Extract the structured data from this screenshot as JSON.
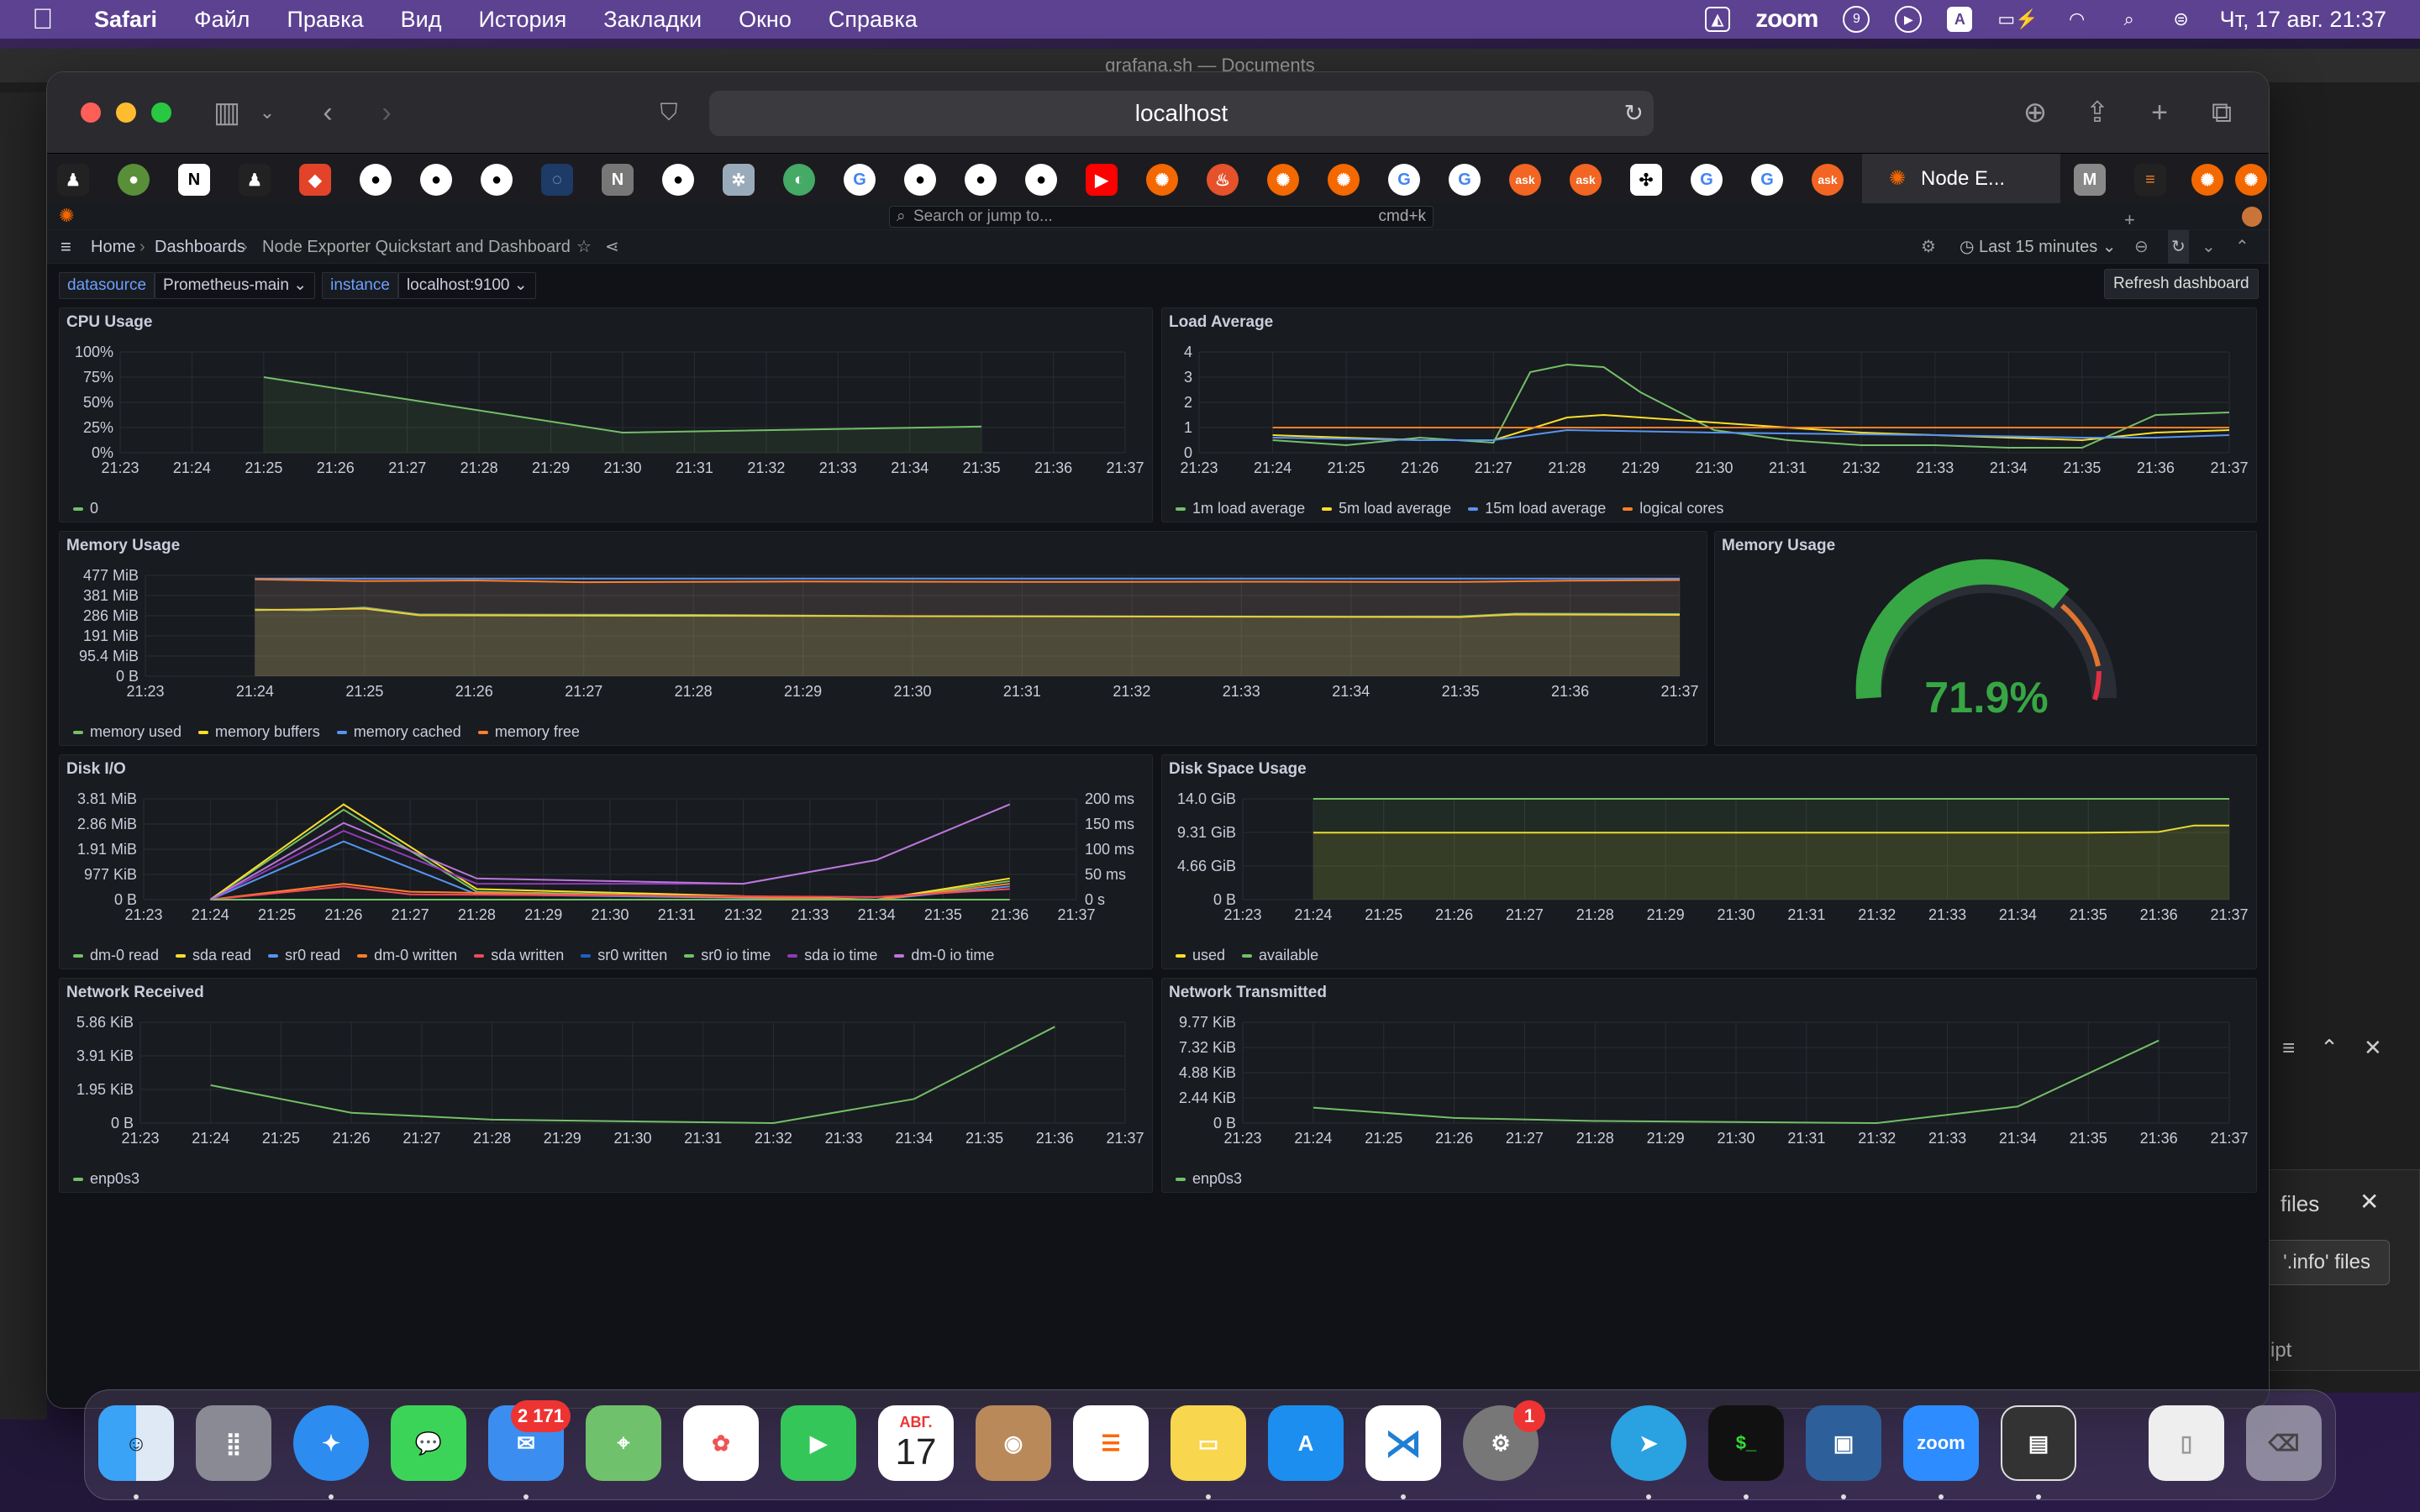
{
  "menubar": {
    "app": "Safari",
    "items": [
      "Файл",
      "Правка",
      "Вид",
      "История",
      "Закладки",
      "Окно",
      "Справка"
    ],
    "zoom": "zoom",
    "datetime": "Чт, 17 авг.  21:37",
    "keyboard": "A",
    "notif_count": "9"
  },
  "vscode": {
    "window_title": "grafana.sh — Documents",
    "files_label": "files",
    "info_label": "'.info' files",
    "script_label": "ipt"
  },
  "safari": {
    "address": "localhost",
    "active_tab": "Node E...",
    "tab_letters": {
      "notion": "N",
      "nav": "N",
      "mail": "M",
      "ask": "ask"
    }
  },
  "grafana": {
    "search_placeholder": "Search or jump to...",
    "search_shortcut": "cmd+k",
    "breadcrumb": {
      "home": "Home",
      "dashboards": "Dashboards",
      "title": "Node Exporter Quickstart and Dashboard",
      "sep": "›"
    },
    "time_range": "Last 15 minutes",
    "refresh_tooltip": "Refresh dashboard",
    "add": "+",
    "vars": [
      {
        "label": "datasource",
        "value": "Prometheus-main"
      },
      {
        "label": "instance",
        "value": "localhost:9100"
      }
    ],
    "gauge": {
      "title": "Memory Usage",
      "value": "71.9%"
    }
  },
  "chart_data": [
    {
      "type": "line",
      "title": "CPU Usage",
      "x": [
        "21:23",
        "21:24",
        "21:25",
        "21:26",
        "21:27",
        "21:28",
        "21:29",
        "21:30",
        "21:31",
        "21:32",
        "21:33",
        "21:34",
        "21:35",
        "21:36",
        "21:37"
      ],
      "yticks": [
        "100%",
        "75%",
        "50%",
        "25%",
        "0%"
      ],
      "ylim": [
        0,
        100
      ],
      "series": [
        {
          "name": "0",
          "color": "#73bf69",
          "points": [
            [
              "21:25",
              75
            ],
            [
              "21:30",
              20
            ],
            [
              "21:35",
              26
            ]
          ]
        }
      ]
    },
    {
      "type": "line",
      "title": "Load Average",
      "x": [
        "21:23",
        "21:24",
        "21:25",
        "21:26",
        "21:27",
        "21:28",
        "21:29",
        "21:30",
        "21:31",
        "21:32",
        "21:33",
        "21:34",
        "21:35",
        "21:36",
        "21:37"
      ],
      "yticks": [
        "4",
        "3",
        "2",
        "1",
        "0"
      ],
      "ylim": [
        0,
        4
      ],
      "series": [
        {
          "name": "1m load average",
          "color": "#73bf69",
          "points": [
            [
              "21:24",
              0.5
            ],
            [
              "21:25",
              0.3
            ],
            [
              "21:26",
              0.6
            ],
            [
              "21:27",
              0.4
            ],
            [
              "21:27.5",
              3.2
            ],
            [
              "21:28",
              3.5
            ],
            [
              "21:28.5",
              3.4
            ],
            [
              "21:29",
              2.4
            ],
            [
              "21:30",
              0.9
            ],
            [
              "21:31",
              0.5
            ],
            [
              "21:32",
              0.3
            ],
            [
              "21:33",
              0.3
            ],
            [
              "21:34",
              0.2
            ],
            [
              "21:35",
              0.2
            ],
            [
              "21:36",
              1.5
            ],
            [
              "21:37",
              1.6
            ]
          ]
        },
        {
          "name": "5m load average",
          "color": "#fade2a",
          "points": [
            [
              "21:24",
              0.7
            ],
            [
              "21:26",
              0.5
            ],
            [
              "21:27",
              0.5
            ],
            [
              "21:28",
              1.4
            ],
            [
              "21:28.5",
              1.5
            ],
            [
              "21:30",
              1.2
            ],
            [
              "21:32",
              0.8
            ],
            [
              "21:34",
              0.6
            ],
            [
              "21:35",
              0.5
            ],
            [
              "21:36",
              0.8
            ],
            [
              "21:37",
              0.9
            ]
          ]
        },
        {
          "name": "15m load average",
          "color": "#5794f2",
          "points": [
            [
              "21:24",
              0.6
            ],
            [
              "21:26",
              0.5
            ],
            [
              "21:27",
              0.5
            ],
            [
              "21:28",
              0.9
            ],
            [
              "21:30",
              0.8
            ],
            [
              "21:33",
              0.7
            ],
            [
              "21:35",
              0.6
            ],
            [
              "21:36",
              0.6
            ],
            [
              "21:37",
              0.7
            ]
          ]
        },
        {
          "name": "logical cores",
          "color": "#ff7f2a",
          "points": [
            [
              "21:24",
              1
            ],
            [
              "21:37",
              1
            ]
          ]
        }
      ]
    },
    {
      "type": "area",
      "title": "Memory Usage",
      "x": [
        "21:23",
        "21:24",
        "21:25",
        "21:26",
        "21:27",
        "21:28",
        "21:29",
        "21:30",
        "21:31",
        "21:32",
        "21:33",
        "21:34",
        "21:35",
        "21:36",
        "21:37"
      ],
      "yticks": [
        "477 MiB",
        "381 MiB",
        "286 MiB",
        "191 MiB",
        "95.4 MiB",
        "0 B"
      ],
      "ylim": [
        0,
        477
      ],
      "series": [
        {
          "name": "memory used",
          "color": "#73bf69",
          "points": [
            [
              "21:24",
              316
            ],
            [
              "21:24.5",
              312
            ],
            [
              "21:25",
              325
            ],
            [
              "21:25.5",
              292
            ],
            [
              "21:28",
              290
            ],
            [
              "21:30",
              284
            ],
            [
              "21:34",
              282
            ],
            [
              "21:35",
              283
            ],
            [
              "21:35.5",
              296
            ],
            [
              "21:37",
              294
            ]
          ]
        },
        {
          "name": "memory buffers",
          "color": "#fade2a",
          "points": [
            [
              "21:24",
              313
            ],
            [
              "21:25",
              320
            ],
            [
              "21:25.5",
              288
            ],
            [
              "21:35",
              280
            ],
            [
              "21:35.5",
              292
            ],
            [
              "21:37",
              290
            ]
          ]
        },
        {
          "name": "memory cached",
          "color": "#5794f2",
          "points": [
            [
              "21:24",
              462
            ],
            [
              "21:37",
              462
            ]
          ]
        },
        {
          "name": "memory free",
          "color": "#ff7f2a",
          "points": [
            [
              "21:24",
              458
            ],
            [
              "21:25",
              450
            ],
            [
              "21:26",
              453
            ],
            [
              "21:27",
              445
            ],
            [
              "21:29",
              448
            ],
            [
              "21:31",
              446
            ],
            [
              "21:33",
              447
            ],
            [
              "21:35",
              446
            ],
            [
              "21:36",
              452
            ],
            [
              "21:37",
              455
            ]
          ]
        }
      ]
    },
    {
      "type": "line",
      "title": "Disk I/O",
      "x": [
        "21:23",
        "21:24",
        "21:25",
        "21:26",
        "21:27",
        "21:28",
        "21:29",
        "21:30",
        "21:31",
        "21:32",
        "21:33",
        "21:34",
        "21:35",
        "21:36",
        "21:37"
      ],
      "yticks": [
        "3.81 MiB",
        "2.86 MiB",
        "1.91 MiB",
        "977 KiB",
        "0 B"
      ],
      "y2ticks": [
        "200 ms",
        "150 ms",
        "100 ms",
        "50 ms",
        "0 s"
      ],
      "ylim": [
        0,
        3.81
      ],
      "series": [
        {
          "name": "dm-0 read",
          "color": "#73bf69",
          "points": [
            [
              "21:24",
              0
            ],
            [
              "21:26",
              3.4
            ],
            [
              "21:28",
              0.3
            ],
            [
              "21:34",
              0
            ],
            [
              "21:36",
              0.7
            ]
          ]
        },
        {
          "name": "sda read",
          "color": "#fade2a",
          "points": [
            [
              "21:24",
              0
            ],
            [
              "21:26",
              3.6
            ],
            [
              "21:28",
              0.4
            ],
            [
              "21:34",
              0
            ],
            [
              "21:36",
              0.8
            ]
          ]
        },
        {
          "name": "sr0 read",
          "color": "#5794f2",
          "points": [
            [
              "21:24",
              0
            ],
            [
              "21:26",
              2.2
            ],
            [
              "21:28",
              0.2
            ],
            [
              "21:34",
              0
            ],
            [
              "21:36",
              0.5
            ]
          ]
        },
        {
          "name": "dm-0 written",
          "color": "#ff7f2a",
          "points": [
            [
              "21:24",
              0
            ],
            [
              "21:26",
              0.6
            ],
            [
              "21:27",
              0.3
            ],
            [
              "21:34",
              0
            ],
            [
              "21:36",
              0.6
            ]
          ]
        },
        {
          "name": "sda written",
          "color": "#f2495c",
          "points": [
            [
              "21:24",
              0
            ],
            [
              "21:26",
              0.5
            ],
            [
              "21:27",
              0.2
            ],
            [
              "21:34",
              0.1
            ],
            [
              "21:36",
              0.4
            ]
          ]
        },
        {
          "name": "sr0 written",
          "color": "#1f60c4",
          "points": [
            [
              "21:24",
              0
            ],
            [
              "21:36",
              0
            ]
          ]
        },
        {
          "name": "sr0 io time",
          "color": "#73bf69",
          "points": [
            [
              "21:24",
              0
            ],
            [
              "21:36",
              0
            ]
          ]
        },
        {
          "name": "sda io time",
          "color": "#8f3bb8",
          "points": [
            [
              "21:24",
              0
            ],
            [
              "21:26",
              2.6
            ],
            [
              "21:28",
              0.6
            ],
            [
              "21:32",
              0.6
            ],
            [
              "21:34",
              1.5
            ],
            [
              "21:36",
              3.6
            ]
          ]
        },
        {
          "name": "dm-0 io time",
          "color": "#b877d9",
          "points": [
            [
              "21:24",
              0
            ],
            [
              "21:26",
              2.9
            ],
            [
              "21:28",
              0.8
            ],
            [
              "21:32",
              0.6
            ],
            [
              "21:34",
              1.5
            ],
            [
              "21:36",
              3.6
            ]
          ]
        }
      ]
    },
    {
      "type": "area",
      "title": "Disk Space Usage",
      "x": [
        "21:23",
        "21:24",
        "21:25",
        "21:26",
        "21:27",
        "21:28",
        "21:29",
        "21:30",
        "21:31",
        "21:32",
        "21:33",
        "21:34",
        "21:35",
        "21:36",
        "21:37"
      ],
      "yticks": [
        "14.0 GiB",
        "9.31 GiB",
        "4.66 GiB",
        "0 B"
      ],
      "ylim": [
        0,
        14
      ],
      "series": [
        {
          "name": "used",
          "color": "#fade2a",
          "points": [
            [
              "21:24",
              9.3
            ],
            [
              "21:35",
              9.3
            ],
            [
              "21:36",
              9.4
            ],
            [
              "21:36.5",
              10.3
            ],
            [
              "21:37",
              10.3
            ]
          ]
        },
        {
          "name": "available",
          "color": "#73bf69",
          "points": [
            [
              "21:24",
              14
            ],
            [
              "21:37",
              14
            ]
          ]
        }
      ]
    },
    {
      "type": "line",
      "title": "Network Received",
      "x": [
        "21:23",
        "21:24",
        "21:25",
        "21:26",
        "21:27",
        "21:28",
        "21:29",
        "21:30",
        "21:31",
        "21:32",
        "21:33",
        "21:34",
        "21:35",
        "21:36",
        "21:37"
      ],
      "yticks": [
        "5.86 KiB",
        "3.91 KiB",
        "1.95 KiB",
        "0 B"
      ],
      "ylim": [
        0,
        5.86
      ],
      "series": [
        {
          "name": "enp0s3",
          "color": "#73bf69",
          "points": [
            [
              "21:24",
              2.2
            ],
            [
              "21:26",
              0.6
            ],
            [
              "21:28",
              0.2
            ],
            [
              "21:30",
              0.1
            ],
            [
              "21:32",
              0
            ],
            [
              "21:34",
              1.4
            ],
            [
              "21:36",
              5.6
            ]
          ]
        }
      ]
    },
    {
      "type": "line",
      "title": "Network Transmitted",
      "x": [
        "21:23",
        "21:24",
        "21:25",
        "21:26",
        "21:27",
        "21:28",
        "21:29",
        "21:30",
        "21:31",
        "21:32",
        "21:33",
        "21:34",
        "21:35",
        "21:36",
        "21:37"
      ],
      "yticks": [
        "9.77 KiB",
        "7.32 KiB",
        "4.88 KiB",
        "2.44 KiB",
        "0 B"
      ],
      "ylim": [
        0,
        9.77
      ],
      "series": [
        {
          "name": "enp0s3",
          "color": "#73bf69",
          "points": [
            [
              "21:24",
              1.5
            ],
            [
              "21:26",
              0.5
            ],
            [
              "21:28",
              0.2
            ],
            [
              "21:30",
              0.1
            ],
            [
              "21:32",
              0
            ],
            [
              "21:34",
              1.6
            ],
            [
              "21:36",
              8
            ]
          ]
        }
      ]
    }
  ],
  "dock": {
    "mail_badge": "2 171",
    "settings_badge": "1",
    "calendar_month": "АВГ.",
    "calendar_day": "17",
    "zoom": "zoom"
  }
}
